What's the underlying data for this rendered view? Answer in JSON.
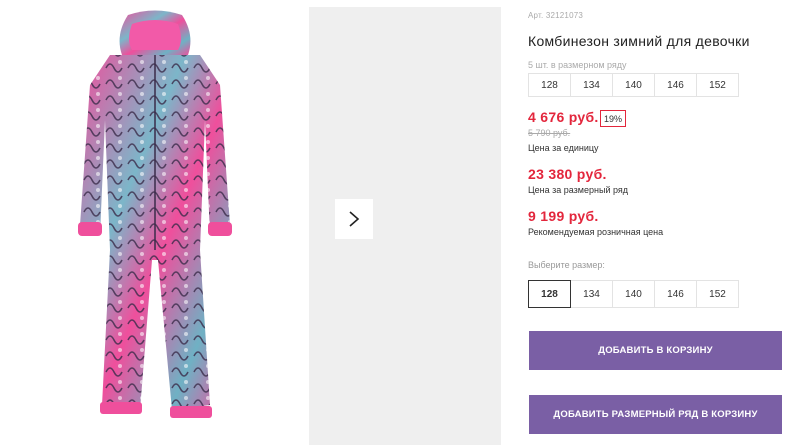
{
  "product": {
    "sku": "Арт. 32121073",
    "title": "Комбинезон зимний для девочки",
    "row_note": "5 шт. в размерном ряду",
    "row_sizes": [
      "128",
      "134",
      "140",
      "146",
      "152"
    ]
  },
  "pricing": {
    "unit_price": "4 676 руб.",
    "discount_badge": "19%",
    "old_price": "5 790 руб.",
    "unit_caption": "Цена за единицу",
    "row_price": "23 380 руб.",
    "row_caption": "Цена за размерный ряд",
    "retail_price": "9 199 руб.",
    "retail_caption": "Рекомендуемая розничная цена"
  },
  "size_picker": {
    "label": "Выберите размер:",
    "sizes": [
      "128",
      "134",
      "140",
      "146",
      "152"
    ],
    "selected": "128"
  },
  "actions": {
    "add_to_cart": "ДОБАВИТЬ В КОРЗИНУ",
    "add_row_to_cart": "ДОБАВИТЬ РАЗМЕРНЫЙ РЯД В КОРЗИНУ"
  },
  "colors": {
    "accent_price": "#e3263c",
    "button": "#7a5fa5",
    "product_pink": "#ef4f9c",
    "product_teal": "#6fb1c4"
  },
  "icons": {
    "gallery_next": "chevron-right-icon"
  }
}
